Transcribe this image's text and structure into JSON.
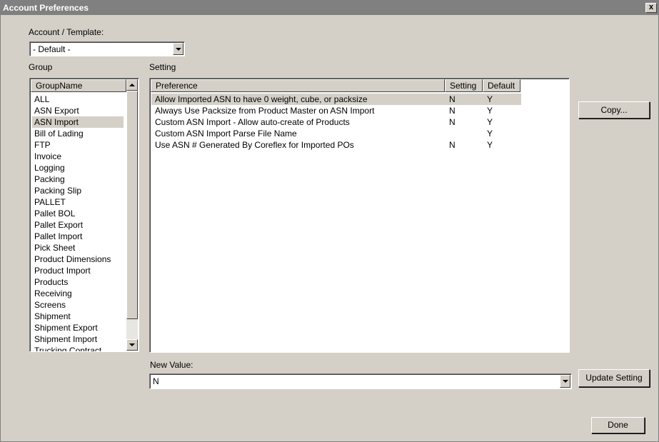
{
  "window": {
    "title": "Account Preferences",
    "close_glyph": "x"
  },
  "account": {
    "label": "Account / Template:",
    "selected": "- Default -"
  },
  "group": {
    "label": "Group",
    "column": "GroupName",
    "items": [
      "ALL",
      "ASN Export",
      "ASN Import",
      "Bill of Lading",
      "FTP",
      "Invoice",
      "Logging",
      "Packing",
      "Packing Slip",
      "PALLET",
      "Pallet BOL",
      "Pallet Export",
      "Pallet Import",
      "Pick Sheet",
      "Product Dimensions",
      "Product Import",
      "Products",
      "Receiving",
      "Screens",
      "Shipment",
      "Shipment Export",
      "Shipment Import",
      "Trucking Contract"
    ],
    "selected_index": 2
  },
  "setting": {
    "label": "Setting",
    "columns": {
      "preference": "Preference",
      "setting": "Setting",
      "default": "Default"
    },
    "rows": [
      {
        "preference": "Allow Imported ASN to have 0 weight, cube, or packsize",
        "setting": "N",
        "default": "Y"
      },
      {
        "preference": "Always Use Packsize from Product Master on ASN Import",
        "setting": "N",
        "default": "Y"
      },
      {
        "preference": "Custom ASN Import - Allow auto-create of Products",
        "setting": "N",
        "default": "Y"
      },
      {
        "preference": "Custom ASN Import Parse File Name",
        "setting": "",
        "default": "Y"
      },
      {
        "preference": "Use ASN # Generated By Coreflex for Imported POs",
        "setting": "N",
        "default": "Y"
      }
    ],
    "selected_index": 0
  },
  "new_value": {
    "label": "New Value:",
    "value": "N"
  },
  "buttons": {
    "copy": "Copy...",
    "update": "Update Setting",
    "done": "Done"
  },
  "icons": {
    "close": "close-icon",
    "dropdown": "chevron-down-icon",
    "scroll_up": "scroll-up-icon",
    "scroll_down": "scroll-down-icon"
  }
}
